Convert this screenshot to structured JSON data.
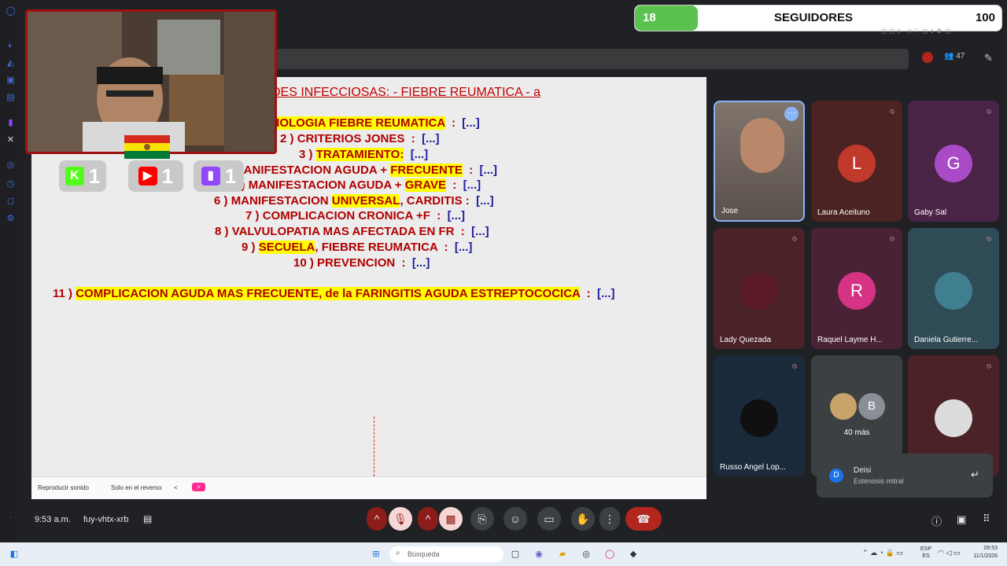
{
  "followers": {
    "count": "18",
    "label": "SEGUIDORES",
    "goal": "100",
    "progress_fraction": 0.18
  },
  "stream_badges": [
    {
      "platform": "kick",
      "count": "1"
    },
    {
      "platform": "youtube",
      "count": "1"
    },
    {
      "platform": "twitch",
      "count": "1"
    }
  ],
  "slide": {
    "title": "DES INFECCIOSAS:  - FIEBRE REUMATICA - a",
    "items": [
      {
        "num": "",
        "parts": [
          {
            "t": "TIOLOGIA FIEBRE REUMATICA",
            "hl": true
          },
          {
            "t": "  :  ",
            "hl": false
          }
        ],
        "bracket": "[...]"
      },
      {
        "num": "2 ) ",
        "parts": [
          {
            "t": "CRITERIOS JONES",
            "hl": false
          },
          {
            "t": "  :  ",
            "hl": false
          }
        ],
        "bracket": "[...]"
      },
      {
        "num": "3 ) ",
        "parts": [
          {
            "t": "TRATAMIENTO:",
            "hl": true
          },
          {
            "t": "  ",
            "hl": false
          }
        ],
        "bracket": "[...]"
      },
      {
        "num": ") ",
        "parts": [
          {
            "t": "MANIFESTACION AGUDA + ",
            "hl": false
          },
          {
            "t": "FRECUENTE",
            "hl": true
          },
          {
            "t": "  :  ",
            "hl": false
          }
        ],
        "bracket": "[...]"
      },
      {
        "num": "5 ) ",
        "parts": [
          {
            "t": "MANIFESTACION AGUDA + ",
            "hl": false
          },
          {
            "t": "GRAVE",
            "hl": true
          },
          {
            "t": "  :  ",
            "hl": false
          }
        ],
        "bracket": "[...]"
      },
      {
        "num": "6 ) ",
        "parts": [
          {
            "t": "MANIFESTACION ",
            "hl": false
          },
          {
            "t": "UNIVERSAL",
            "hl": true
          },
          {
            "t": ", CARDITIS",
            "hl": false
          },
          {
            "t": " :  ",
            "hl": false
          }
        ],
        "bracket": "[...]"
      },
      {
        "num": "7 ) ",
        "parts": [
          {
            "t": "COMPLICACION CRONICA +F",
            "hl": false
          },
          {
            "t": "  :  ",
            "hl": false
          }
        ],
        "bracket": "[...]"
      },
      {
        "num": "8 ) ",
        "parts": [
          {
            "t": "VALVULOPATIA MAS AFECTADA EN FR",
            "hl": false
          },
          {
            "t": "  :  ",
            "hl": false
          }
        ],
        "bracket": "[...]"
      },
      {
        "num": "9 ) ",
        "parts": [
          {
            "t": "SECUELA",
            "hl": true
          },
          {
            "t": ", FIEBRE REUMATICA",
            "hl": false
          },
          {
            "t": "  :  ",
            "hl": false
          }
        ],
        "bracket": "[...]"
      },
      {
        "num": "10 ) ",
        "parts": [
          {
            "t": "PREVENCION",
            "hl": false
          },
          {
            "t": "  :  ",
            "hl": false
          }
        ],
        "bracket": "[...]"
      },
      {
        "num": "11 ) ",
        "parts": [
          {
            "t": "COMPLICACION AGUDA MAS FRECUENTE, de la FARINGITIS AGUDA ESTREPTOCOCICA",
            "hl": true
          },
          {
            "t": "  :  ",
            "hl": false
          }
        ],
        "bracket": "[...]"
      }
    ],
    "footer": {
      "play_sound": "Reproducir sonido",
      "reverse_only": "Solo en el reverso",
      "prev": "<",
      "next": ">"
    }
  },
  "participants": [
    {
      "name": "Jose",
      "initial": "",
      "color": "#6b625d",
      "muted": false,
      "kind": "video"
    },
    {
      "name": "Laura Aceituno",
      "initial": "L",
      "color": "#c0392b",
      "muted": true,
      "kind": "letter"
    },
    {
      "name": "Gaby Sal",
      "initial": "G",
      "color": "#a94bc7",
      "muted": true,
      "kind": "letter"
    },
    {
      "name": "Lady Quezada",
      "initial": "",
      "color": "#5a1b27",
      "muted": true,
      "kind": "photo"
    },
    {
      "name": "Raquel Layme H...",
      "initial": "R",
      "color": "#d63384",
      "muted": true,
      "kind": "letter"
    },
    {
      "name": "Daniela Gutierre...",
      "initial": "",
      "color": "#3f7f8f",
      "muted": true,
      "kind": "photo"
    },
    {
      "name": "Russo Angel Lop...",
      "initial": "",
      "color": "#101010",
      "muted": true,
      "kind": "photo"
    },
    {
      "name": "40 más",
      "initial": "B",
      "color": "#8a8f97",
      "muted": false,
      "kind": "more"
    },
    {
      "name": "",
      "initial": "",
      "color": "#dcdcdc",
      "muted": true,
      "kind": "photo"
    }
  ],
  "chat_notice": {
    "initial": "D",
    "name": "Deisi",
    "message": "Estenosis mitral"
  },
  "meeting": {
    "time": "9:53 a.m.",
    "code": "fuy-vhtx-xrb"
  },
  "top_strip": {
    "viewers": "47"
  },
  "taskbar": {
    "search_placeholder": "Búsqueda",
    "lang_top": "ESP",
    "lang_bottom": "ES",
    "clock": "09:53",
    "date": "11/1/2026"
  }
}
